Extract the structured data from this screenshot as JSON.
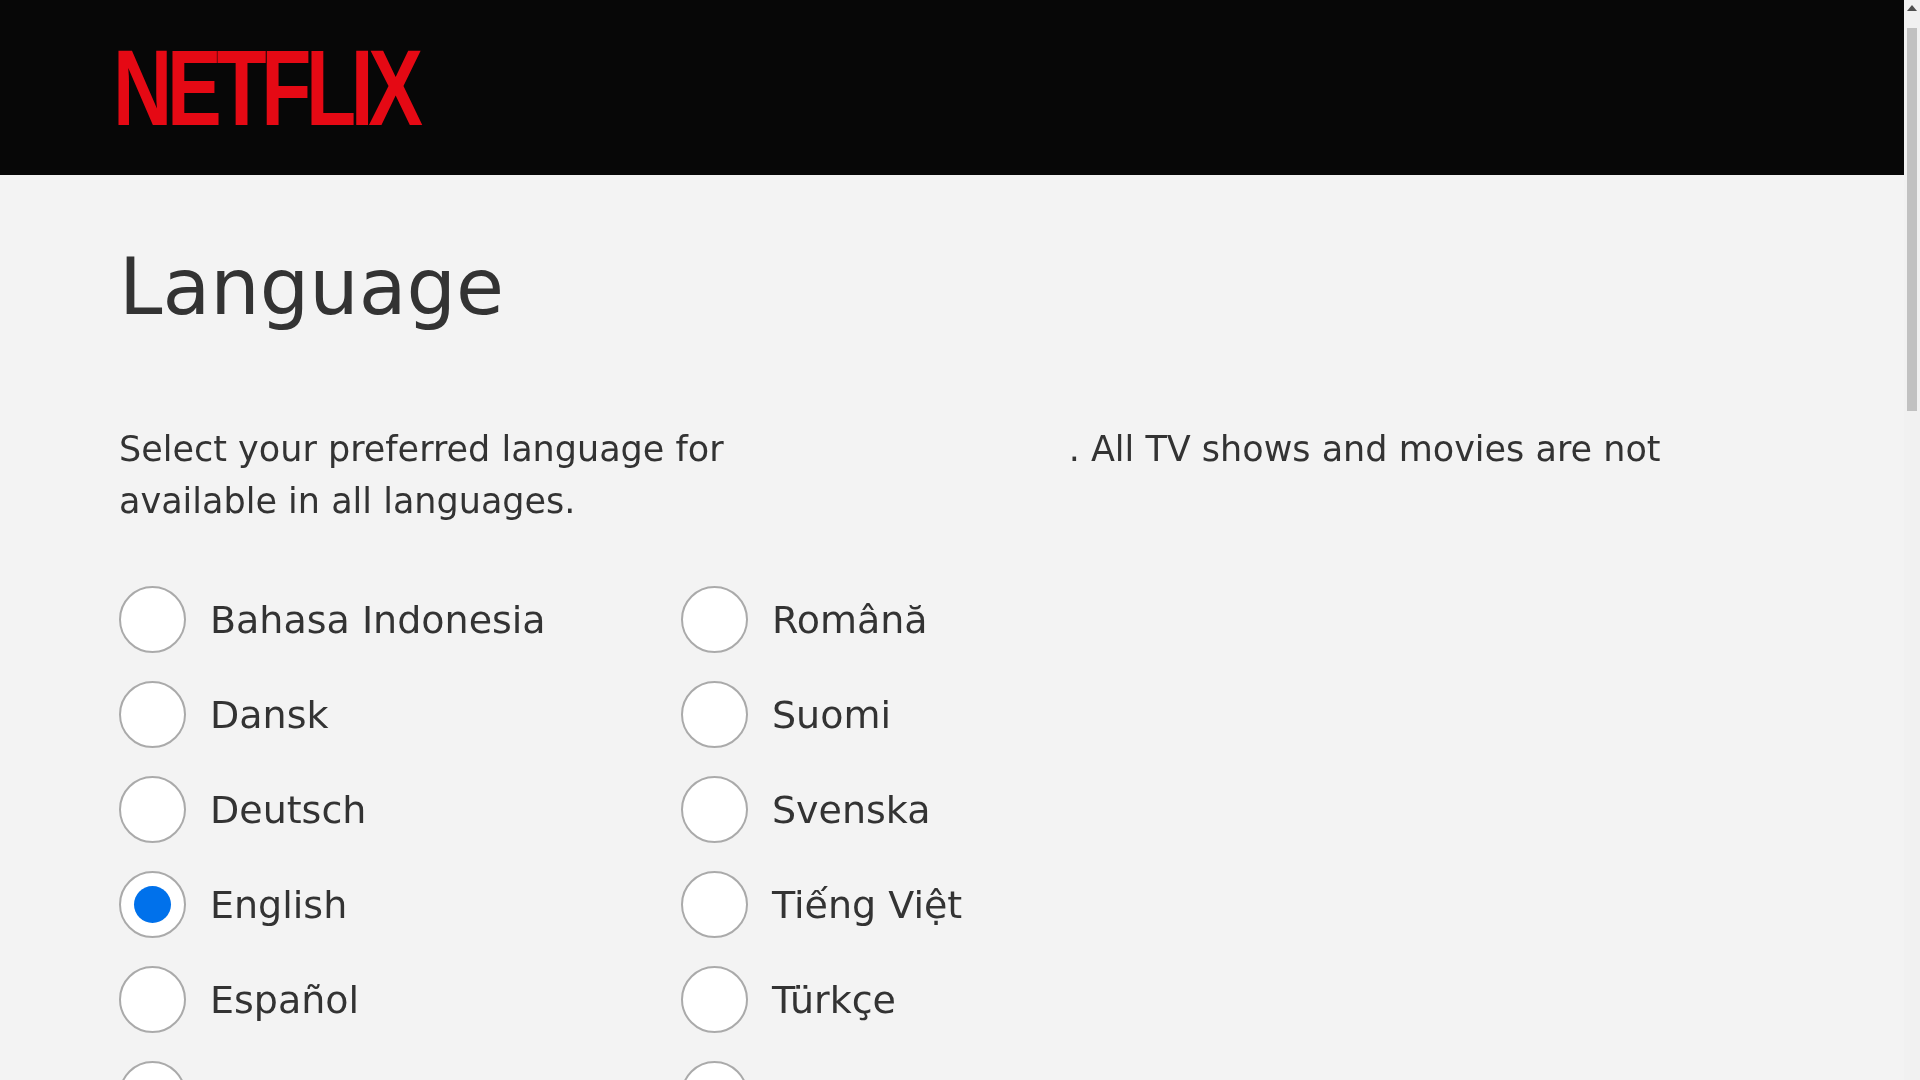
{
  "header": {
    "logo": "NETFLIX"
  },
  "title": "Language",
  "intro": {
    "before": "Select your preferred language for",
    "after": ". All TV shows and movies are not available in all languages."
  },
  "columns": [
    [
      {
        "label": "Bahasa Indonesia",
        "selected": false
      },
      {
        "label": "Dansk",
        "selected": false
      },
      {
        "label": "Deutsch",
        "selected": false
      },
      {
        "label": "English",
        "selected": true
      },
      {
        "label": "Español",
        "selected": false
      },
      {
        "selected": false
      }
    ],
    [
      {
        "label": "Română",
        "selected": false
      },
      {
        "label": "Suomi",
        "selected": false
      },
      {
        "label": "Svenska",
        "selected": false
      },
      {
        "label": "Tiếng Việt",
        "selected": false
      },
      {
        "label": "Türkçe",
        "selected": false
      },
      {
        "selected": false
      }
    ]
  ]
}
